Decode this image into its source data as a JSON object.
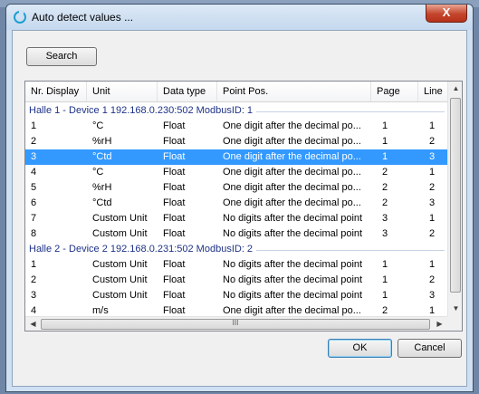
{
  "window": {
    "title": "Auto detect values ...",
    "close_label": "X"
  },
  "buttons": {
    "search": "Search",
    "ok": "OK",
    "cancel": "Cancel"
  },
  "columns": [
    "Nr. Display",
    "Unit",
    "Data type",
    "Point Pos.",
    "Page",
    "Line"
  ],
  "groups": [
    {
      "label": "Halle 1 - Device 1 192.168.0.230:502 ModbusID: 1",
      "rows": [
        [
          "1",
          "°C",
          "Float",
          "One digit after the decimal po...",
          "1",
          "1"
        ],
        [
          "2",
          "%rH",
          "Float",
          "One digit after the decimal po...",
          "1",
          "2"
        ],
        [
          "3",
          "°Ctd",
          "Float",
          "One digit after the decimal po...",
          "1",
          "3"
        ],
        [
          "4",
          "°C",
          "Float",
          "One digit after the decimal po...",
          "2",
          "1"
        ],
        [
          "5",
          "%rH",
          "Float",
          "One digit after the decimal po...",
          "2",
          "2"
        ],
        [
          "6",
          "°Ctd",
          "Float",
          "One digit after the decimal po...",
          "2",
          "3"
        ],
        [
          "7",
          "Custom Unit",
          "Float",
          "No digits after the decimal point",
          "3",
          "1"
        ],
        [
          "8",
          "Custom Unit",
          "Float",
          "No digits after the decimal point",
          "3",
          "2"
        ]
      ]
    },
    {
      "label": "Halle 2 - Device 2 192.168.0.231:502 ModbusID: 2",
      "rows": [
        [
          "1",
          "Custom Unit",
          "Float",
          "No digits after the decimal point",
          "1",
          "1"
        ],
        [
          "2",
          "Custom Unit",
          "Float",
          "No digits after the decimal point",
          "1",
          "2"
        ],
        [
          "3",
          "Custom Unit",
          "Float",
          "No digits after the decimal point",
          "1",
          "3"
        ],
        [
          "4",
          "m/s",
          "Float",
          "One digit after the decimal po...",
          "2",
          "1"
        ]
      ]
    }
  ],
  "selected_row": {
    "group": 0,
    "row": 2
  },
  "scroll": {
    "h_thumb_glyph": "III"
  },
  "colors": {
    "selection": "#3399ff",
    "group_text": "#1e3287"
  }
}
